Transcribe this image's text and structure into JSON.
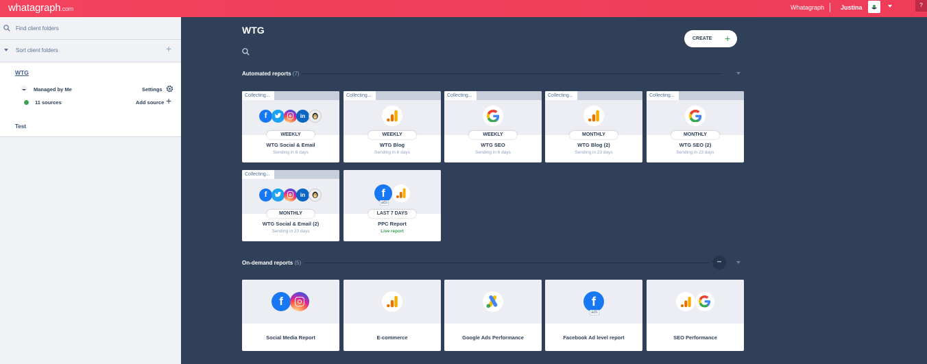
{
  "topbar": {
    "logo": "whatagraph",
    "logo_suffix": ".com",
    "link_whatagraph": "Whatagraph",
    "user_name": "Justina",
    "help": "?"
  },
  "sidebar": {
    "search_placeholder": "Find client folders",
    "sort_label": "Sort client folders",
    "folders": [
      {
        "name": "WTG",
        "owner": "Managed by Me",
        "settings": "Settings",
        "sources": "11 sources",
        "add_source": "Add source"
      },
      {
        "name": "Test"
      }
    ]
  },
  "main": {
    "title": "WTG",
    "create_label": "CREATE",
    "automated": {
      "label": "Automated reports",
      "count": "(7)",
      "cards": [
        {
          "collecting": "Collecting...",
          "frequency": "WEEKLY",
          "name": "WTG Social & Email",
          "status": "Sending in 6 days",
          "icons": [
            "facebook",
            "twitter",
            "instagram",
            "linkedin",
            "mailchimp"
          ]
        },
        {
          "collecting": "Collecting...",
          "frequency": "WEEKLY",
          "name": "WTG Blog",
          "status": "Sending in 6 days",
          "icons": [
            "google-analytics"
          ]
        },
        {
          "collecting": "Collecting...",
          "frequency": "WEEKLY",
          "name": "WTG SEO",
          "status": "Sending in 6 days",
          "icons": [
            "google"
          ]
        },
        {
          "collecting": "Collecting...",
          "frequency": "MONTHLY",
          "name": "WTG Blog (2)",
          "status": "Sending in 23 days",
          "icons": [
            "google-analytics"
          ]
        },
        {
          "collecting": "Collecting...",
          "frequency": "MONTHLY",
          "name": "WTG SEO (2)",
          "status": "Sending in 23 days",
          "icons": [
            "google"
          ]
        },
        {
          "collecting": "Collecting...",
          "frequency": "MONTHLY",
          "name": "WTG Social & Email (2)",
          "status": "Sending in 23 days",
          "icons": [
            "facebook",
            "twitter",
            "instagram",
            "linkedin",
            "mailchimp"
          ]
        },
        {
          "frequency": "LAST 7 DAYS",
          "name": "PPC Report",
          "status": "Live report",
          "icons": [
            "facebook-ads",
            "google-analytics"
          ]
        }
      ]
    },
    "ondemand": {
      "label": "On-demand reports",
      "count": "(5)",
      "more": "•••",
      "cards": [
        {
          "name": "Social Media Report",
          "icons": [
            "facebook",
            "instagram"
          ]
        },
        {
          "name": "E-commerce",
          "icons": [
            "google-analytics"
          ]
        },
        {
          "name": "Google Ads Performance",
          "icons": [
            "google-ads"
          ]
        },
        {
          "name": "Facebook Ad level report",
          "icons": [
            "facebook-ads"
          ]
        },
        {
          "name": "SEO Performance",
          "icons": [
            "google-analytics",
            "google"
          ]
        }
      ]
    },
    "ads_badge": "ads"
  },
  "colors": {
    "accent": "#f2425e",
    "main_bg": "#2f4058",
    "sidebar_bg": "#f1f2f5",
    "live": "#3aa05a"
  }
}
